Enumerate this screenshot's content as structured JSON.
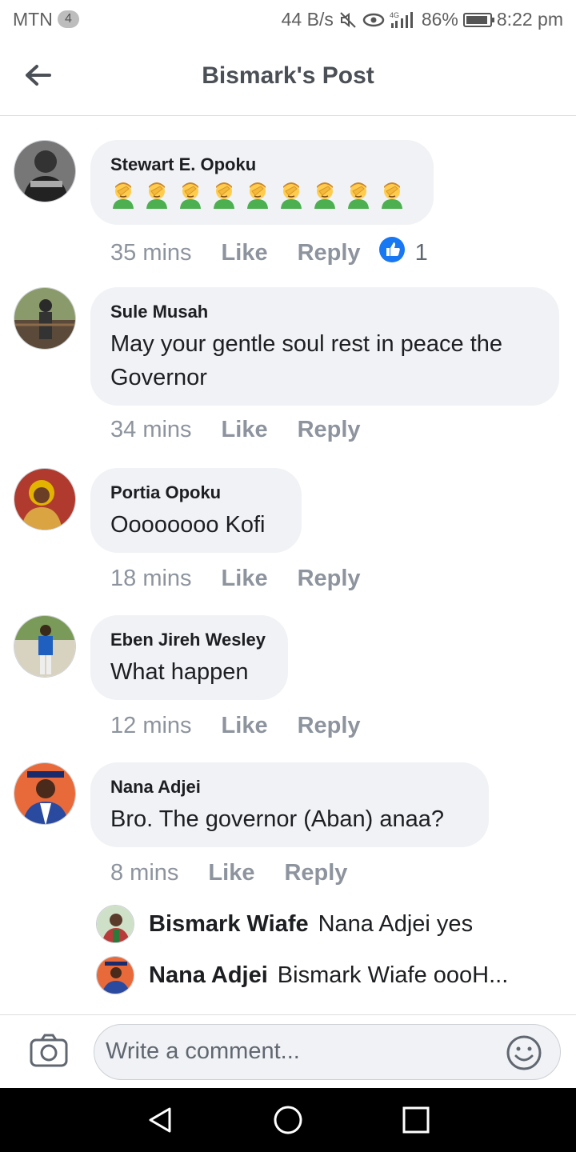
{
  "status_bar": {
    "carrier": "MTN",
    "sim_badge": "4",
    "speed": "44 B/s",
    "network": "4G",
    "battery": "86%",
    "time": "8:22 pm"
  },
  "header": {
    "title": "Bismark's Post",
    "back_icon": "arrow-left-icon"
  },
  "comments": [
    {
      "name": "Stewart E. Opoku",
      "emoji_count": 9,
      "emoji": "facepalm-emoji",
      "time": "35 mins",
      "like_label": "Like",
      "reply_label": "Reply",
      "reaction_icon": "thumbs-up-icon",
      "reaction_count": "1"
    },
    {
      "name": "Sule Musah",
      "text_line1": "May your gentle soul rest in peace the",
      "text_line2": "Governor",
      "time": "34 mins",
      "like_label": "Like",
      "reply_label": "Reply"
    },
    {
      "name": "Portia Opoku",
      "text": "Oooooooo Kofi",
      "time": "18 mins",
      "like_label": "Like",
      "reply_label": "Reply"
    },
    {
      "name": "Eben Jireh Wesley",
      "text": "What happen",
      "time": "12 mins",
      "like_label": "Like",
      "reply_label": "Reply"
    },
    {
      "name": "Nana Adjei",
      "text": "Bro. The governor (Aban) anaa?",
      "time": "8 mins",
      "like_label": "Like",
      "reply_label": "Reply"
    }
  ],
  "replies": [
    {
      "name": "Bismark Wiafe",
      "text": "Nana Adjei yes"
    },
    {
      "name": "Nana Adjei",
      "text": "Bismark Wiafe oooH..."
    }
  ],
  "composer": {
    "placeholder": "Write a comment...",
    "camera_icon": "camera-icon",
    "emoji_icon": "smiley-icon"
  },
  "colors": {
    "bubble": "#f0f2f5",
    "meta_text": "#8d949e",
    "like_blue": "#1877f2"
  }
}
